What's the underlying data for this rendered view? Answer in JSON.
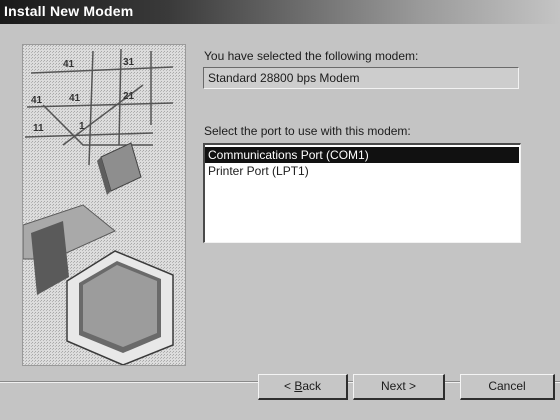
{
  "window": {
    "title": "Install New Modem"
  },
  "modem": {
    "label": "You have selected the following modem:",
    "value": "Standard 28800 bps Modem"
  },
  "port": {
    "label": "Select the port to use with this modem:",
    "options": [
      "Communications Port (COM1)",
      "Printer Port (LPT1)"
    ],
    "selected_index": 0
  },
  "buttons": {
    "back_prefix": "< ",
    "back_accel": "B",
    "back_rest": "ack",
    "next": "Next >",
    "cancel": "Cancel"
  },
  "colors": {
    "titlebar": "#1a1a1a",
    "face": "#c4c4c4",
    "selection": "#111111"
  },
  "icons": {
    "illustration": "modem-setup-illustration"
  }
}
